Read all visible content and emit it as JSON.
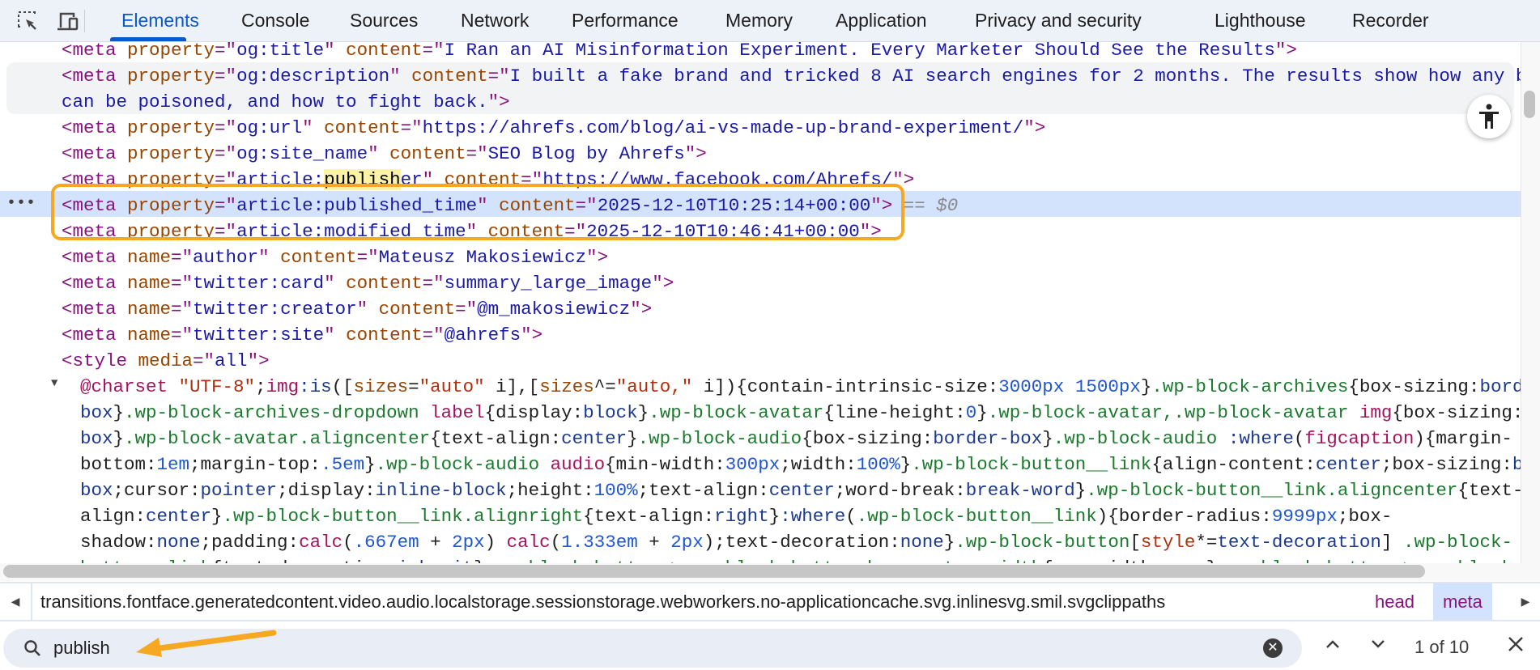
{
  "toolbar": {
    "icons": [
      "inspect-element-icon",
      "device-toolbar-icon"
    ],
    "tabs": [
      {
        "label": "Elements",
        "active": true
      },
      {
        "label": "Console"
      },
      {
        "label": "Sources"
      },
      {
        "label": "Network"
      },
      {
        "label": "Performance"
      },
      {
        "label": "Memory"
      },
      {
        "label": "Application"
      },
      {
        "label": "Privacy and security"
      },
      {
        "label": "Lighthouse"
      },
      {
        "label": "Recorder"
      }
    ]
  },
  "elements": {
    "selected_marker": "== $0",
    "lines": [
      [
        [
          "t",
          "<meta"
        ],
        [
          "an",
          " property"
        ],
        [
          "p",
          "=\""
        ],
        [
          "av",
          "og:title"
        ],
        [
          "p",
          "\""
        ],
        [
          "an",
          " content"
        ],
        [
          "p",
          "=\""
        ],
        [
          "av",
          "I Ran an AI Misinformation Experiment. Every Marketer Should See the Results"
        ],
        [
          "p",
          "\">"
        ]
      ],
      [
        [
          "t",
          "<meta"
        ],
        [
          "an",
          " property"
        ],
        [
          "p",
          "=\""
        ],
        [
          "av",
          "og:description"
        ],
        [
          "p",
          "\""
        ],
        [
          "an",
          " content"
        ],
        [
          "p",
          "=\""
        ],
        [
          "av",
          "I built a fake brand and tricked 8 AI search engines for 2 months. The results show how any bra"
        ]
      ],
      [
        [
          "av",
          "can be poisoned, and how to fight back."
        ],
        [
          "p",
          "\">"
        ]
      ],
      [
        [
          "t",
          "<meta"
        ],
        [
          "an",
          " property"
        ],
        [
          "p",
          "=\""
        ],
        [
          "av",
          "og:url"
        ],
        [
          "p",
          "\""
        ],
        [
          "an",
          " content"
        ],
        [
          "p",
          "=\""
        ],
        [
          "av",
          "https://ahrefs.com/blog/ai-vs-made-up-brand-experiment/"
        ],
        [
          "p",
          "\">"
        ]
      ],
      [
        [
          "t",
          "<meta"
        ],
        [
          "an",
          " property"
        ],
        [
          "p",
          "=\""
        ],
        [
          "av",
          "og:site_name"
        ],
        [
          "p",
          "\""
        ],
        [
          "an",
          " content"
        ],
        [
          "p",
          "=\""
        ],
        [
          "av",
          "SEO Blog by Ahrefs"
        ],
        [
          "p",
          "\">"
        ]
      ],
      [
        [
          "t",
          "<meta"
        ],
        [
          "an",
          " property"
        ],
        [
          "p",
          "=\""
        ],
        [
          "av",
          "article:"
        ],
        [
          "hl",
          "publish"
        ],
        [
          "av",
          "er"
        ],
        [
          "p",
          "\""
        ],
        [
          "an",
          " content"
        ],
        [
          "p",
          "=\""
        ],
        [
          "av",
          "https://www.facebook.com/Ahrefs/"
        ],
        [
          "p",
          "\">"
        ]
      ],
      [
        [
          "t",
          "<meta"
        ],
        [
          "an",
          " property"
        ],
        [
          "p",
          "=\""
        ],
        [
          "av",
          "article:published_time"
        ],
        [
          "p",
          "\""
        ],
        [
          "an",
          " content"
        ],
        [
          "p",
          "=\""
        ],
        [
          "av",
          "2025-12-10T10:25:14+00:00"
        ],
        [
          "p",
          "\">"
        ],
        [
          "dim",
          " == $0"
        ]
      ],
      [
        [
          "t",
          "<meta"
        ],
        [
          "an",
          " property"
        ],
        [
          "p",
          "=\""
        ],
        [
          "av",
          "article:modified_time"
        ],
        [
          "p",
          "\""
        ],
        [
          "an",
          " content"
        ],
        [
          "p",
          "=\""
        ],
        [
          "av",
          "2025-12-10T10:46:41+00:00"
        ],
        [
          "p",
          "\">"
        ]
      ],
      [
        [
          "t",
          "<meta"
        ],
        [
          "an",
          " name"
        ],
        [
          "p",
          "=\""
        ],
        [
          "av",
          "author"
        ],
        [
          "p",
          "\""
        ],
        [
          "an",
          " content"
        ],
        [
          "p",
          "=\""
        ],
        [
          "av",
          "Mateusz Makosiewicz"
        ],
        [
          "p",
          "\">"
        ]
      ],
      [
        [
          "t",
          "<meta"
        ],
        [
          "an",
          " name"
        ],
        [
          "p",
          "=\""
        ],
        [
          "av",
          "twitter:card"
        ],
        [
          "p",
          "\""
        ],
        [
          "an",
          " content"
        ],
        [
          "p",
          "=\""
        ],
        [
          "av",
          "summary_large_image"
        ],
        [
          "p",
          "\">"
        ]
      ],
      [
        [
          "t",
          "<meta"
        ],
        [
          "an",
          " name"
        ],
        [
          "p",
          "=\""
        ],
        [
          "av",
          "twitter:creator"
        ],
        [
          "p",
          "\""
        ],
        [
          "an",
          " content"
        ],
        [
          "p",
          "=\""
        ],
        [
          "av",
          "@m_makosiewicz"
        ],
        [
          "p",
          "\">"
        ]
      ],
      [
        [
          "t",
          "<meta"
        ],
        [
          "an",
          " name"
        ],
        [
          "p",
          "=\""
        ],
        [
          "av",
          "twitter:site"
        ],
        [
          "p",
          "\""
        ],
        [
          "an",
          " content"
        ],
        [
          "p",
          "=\""
        ],
        [
          "av",
          "@ahrefs"
        ],
        [
          "p",
          "\">"
        ]
      ],
      [
        [
          "t",
          "<style"
        ],
        [
          "an",
          " media"
        ],
        [
          "p",
          "=\""
        ],
        [
          "av",
          "all"
        ],
        [
          "p",
          "\">"
        ]
      ]
    ],
    "css_lines": [
      [
        [
          "at",
          "@charset"
        ],
        [
          "s",
          " \"UTF-8\""
        ],
        [
          "x",
          ";"
        ],
        [
          "tg",
          "img"
        ],
        [
          "ps",
          ":is"
        ],
        [
          "x",
          "(["
        ],
        [
          "an",
          "sizes"
        ],
        [
          "x",
          "="
        ],
        [
          "s",
          "\"auto\""
        ],
        [
          "x",
          " i],["
        ],
        [
          "an",
          "sizes"
        ],
        [
          "x",
          "^="
        ],
        [
          "s",
          "\"auto,\""
        ],
        [
          "x",
          " i]){contain-intrinsic-size:"
        ],
        [
          "n",
          "3000px"
        ],
        [
          "x",
          " "
        ],
        [
          "n",
          "1500px"
        ],
        [
          "x",
          "}"
        ],
        [
          "sel",
          ".wp-block-archives"
        ],
        [
          "x",
          "{box-sizing:"
        ],
        [
          "v",
          "border"
        ]
      ],
      [
        [
          "v",
          "box"
        ],
        [
          "x",
          "}"
        ],
        [
          "sel",
          ".wp-block-archives-dropdown"
        ],
        [
          "x",
          " "
        ],
        [
          "tg",
          "label"
        ],
        [
          "x",
          "{display:"
        ],
        [
          "v",
          "block"
        ],
        [
          "x",
          "}"
        ],
        [
          "sel",
          ".wp-block-avatar"
        ],
        [
          "x",
          "{line-height:"
        ],
        [
          "n",
          "0"
        ],
        [
          "x",
          "}"
        ],
        [
          "sel",
          ".wp-block-avatar,.wp-block-avatar"
        ],
        [
          "x",
          " "
        ],
        [
          "tg",
          "img"
        ],
        [
          "x",
          "{box-sizing:"
        ],
        [
          "v",
          "bo"
        ]
      ],
      [
        [
          "v",
          "box"
        ],
        [
          "x",
          "}"
        ],
        [
          "sel",
          ".wp-block-avatar.aligncenter"
        ],
        [
          "x",
          "{text-align:"
        ],
        [
          "v",
          "center"
        ],
        [
          "x",
          "}"
        ],
        [
          "sel",
          ".wp-block-audio"
        ],
        [
          "x",
          "{box-sizing:"
        ],
        [
          "v",
          "border-box"
        ],
        [
          "x",
          "}"
        ],
        [
          "sel",
          ".wp-block-audio"
        ],
        [
          "x",
          " "
        ],
        [
          "ps",
          ":where"
        ],
        [
          "x",
          "("
        ],
        [
          "tg",
          "figcaption"
        ],
        [
          "x",
          "){margin-"
        ]
      ],
      [
        [
          "x",
          "bottom:"
        ],
        [
          "n",
          "1em"
        ],
        [
          "x",
          ";margin-top:"
        ],
        [
          "n",
          ".5em"
        ],
        [
          "x",
          "}"
        ],
        [
          "sel",
          ".wp-block-audio"
        ],
        [
          "x",
          " "
        ],
        [
          "tg",
          "audio"
        ],
        [
          "x",
          "{min-width:"
        ],
        [
          "n",
          "300px"
        ],
        [
          "x",
          ";width:"
        ],
        [
          "n",
          "100%"
        ],
        [
          "x",
          "}"
        ],
        [
          "sel",
          ".wp-block-button__link"
        ],
        [
          "x",
          "{align-content:"
        ],
        [
          "v",
          "center"
        ],
        [
          "x",
          ";box-sizing:"
        ],
        [
          "v",
          "bor"
        ]
      ],
      [
        [
          "v",
          "box"
        ],
        [
          "x",
          ";cursor:"
        ],
        [
          "v",
          "pointer"
        ],
        [
          "x",
          ";display:"
        ],
        [
          "v",
          "inline-block"
        ],
        [
          "x",
          ";height:"
        ],
        [
          "n",
          "100%"
        ],
        [
          "x",
          ";text-align:"
        ],
        [
          "v",
          "center"
        ],
        [
          "x",
          ";word-break:"
        ],
        [
          "v",
          "break-word"
        ],
        [
          "x",
          "}"
        ],
        [
          "sel",
          ".wp-block-button__link.aligncenter"
        ],
        [
          "x",
          "{text-"
        ]
      ],
      [
        [
          "x",
          "align:"
        ],
        [
          "v",
          "center"
        ],
        [
          "x",
          "}"
        ],
        [
          "sel",
          ".wp-block-button__link.alignright"
        ],
        [
          "x",
          "{text-align:"
        ],
        [
          "v",
          "right"
        ],
        [
          "x",
          "}"
        ],
        [
          "ps",
          ":where"
        ],
        [
          "x",
          "("
        ],
        [
          "sel",
          ".wp-block-button__link"
        ],
        [
          "x",
          "){border-radius:"
        ],
        [
          "n",
          "9999px"
        ],
        [
          "x",
          ";box-"
        ]
      ],
      [
        [
          "x",
          "shadow:"
        ],
        [
          "v",
          "none"
        ],
        [
          "x",
          ";padding:"
        ],
        [
          "fn",
          "calc"
        ],
        [
          "x",
          "("
        ],
        [
          "n",
          ".667em"
        ],
        [
          "x",
          " + "
        ],
        [
          "n",
          "2px"
        ],
        [
          "x",
          ") "
        ],
        [
          "fn",
          "calc"
        ],
        [
          "x",
          "("
        ],
        [
          "n",
          "1.333em"
        ],
        [
          "x",
          " + "
        ],
        [
          "n",
          "2px"
        ],
        [
          "x",
          ");text-decoration:"
        ],
        [
          "v",
          "none"
        ],
        [
          "x",
          "}"
        ],
        [
          "sel",
          ".wp-block-button"
        ],
        [
          "x",
          "["
        ],
        [
          "s",
          "style"
        ],
        [
          "x",
          "*="
        ],
        [
          "v",
          "text-decoration"
        ],
        [
          "x",
          "] "
        ],
        [
          "sel",
          ".wp-block-"
        ]
      ],
      [
        [
          "sel",
          "button__link"
        ],
        [
          "x",
          "{text-decoration:"
        ],
        [
          "v",
          "inherit"
        ],
        [
          "x",
          "}"
        ],
        [
          "sel",
          ".wp-block-buttons>.wp-block-button.has-custom-width"
        ],
        [
          "x",
          "{max-width:"
        ],
        [
          "v",
          "none"
        ],
        [
          "x",
          "}"
        ],
        [
          "sel",
          ".wp-block-buttons>.wp-block-"
        ]
      ]
    ]
  },
  "breadcrumbs": {
    "path": "transitions.fontface.generatedcontent.video.audio.localstorage.sessionstorage.webworkers.no-applicationcache.svg.inlinesvg.smil.svgclippaths",
    "items": [
      "head",
      "meta"
    ]
  },
  "search": {
    "value": "publish",
    "match_count": "1 of 10"
  },
  "colors": {
    "accent": "#0b57d0",
    "annotation": "#f7a823",
    "selected_row": "#d3e3fd"
  }
}
